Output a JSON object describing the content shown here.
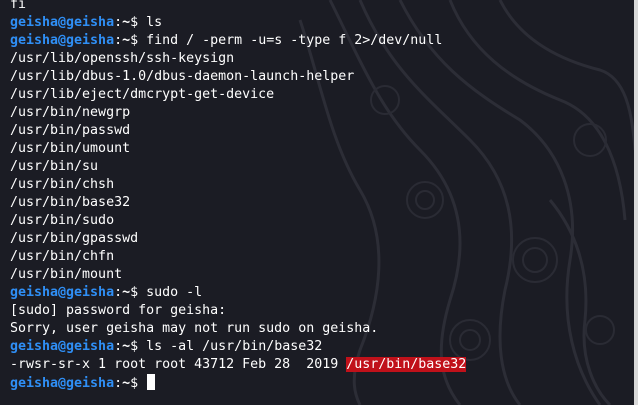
{
  "prompt": {
    "user_host": "geisha@geisha",
    "sep": ":",
    "cwd": "~",
    "symbol": "$ "
  },
  "lines": [
    {
      "kind": "output",
      "text": "fi"
    },
    {
      "kind": "cmd",
      "text": "ls"
    },
    {
      "kind": "cmd",
      "text": "find / -perm -u=s -type f 2>/dev/null"
    },
    {
      "kind": "output",
      "text": "/usr/lib/openssh/ssh-keysign"
    },
    {
      "kind": "output",
      "text": "/usr/lib/dbus-1.0/dbus-daemon-launch-helper"
    },
    {
      "kind": "output",
      "text": "/usr/lib/eject/dmcrypt-get-device"
    },
    {
      "kind": "output",
      "text": "/usr/bin/newgrp"
    },
    {
      "kind": "output",
      "text": "/usr/bin/passwd"
    },
    {
      "kind": "output",
      "text": "/usr/bin/umount"
    },
    {
      "kind": "output",
      "text": "/usr/bin/su"
    },
    {
      "kind": "output",
      "text": "/usr/bin/chsh"
    },
    {
      "kind": "output",
      "text": "/usr/bin/base32"
    },
    {
      "kind": "output",
      "text": "/usr/bin/sudo"
    },
    {
      "kind": "output",
      "text": "/usr/bin/gpasswd"
    },
    {
      "kind": "output",
      "text": "/usr/bin/chfn"
    },
    {
      "kind": "output",
      "text": "/usr/bin/mount"
    },
    {
      "kind": "cmd",
      "text": "sudo -l"
    },
    {
      "kind": "output",
      "text": "[sudo] password for geisha:"
    },
    {
      "kind": "output",
      "text": "Sorry, user geisha may not run sudo on geisha."
    },
    {
      "kind": "cmd",
      "text": "ls -al /usr/bin/base32"
    },
    {
      "kind": "output",
      "text": "-rwsr-sr-x 1 root root 43712 Feb 28  2019 ",
      "highlight": "/usr/bin/base32"
    },
    {
      "kind": "cmd",
      "text": "",
      "cursor": true
    }
  ],
  "colors": {
    "background": "#1b1c24",
    "user_host": "#2f8ff6",
    "text": "#ffffff",
    "highlight_bg": "#c0111a"
  }
}
